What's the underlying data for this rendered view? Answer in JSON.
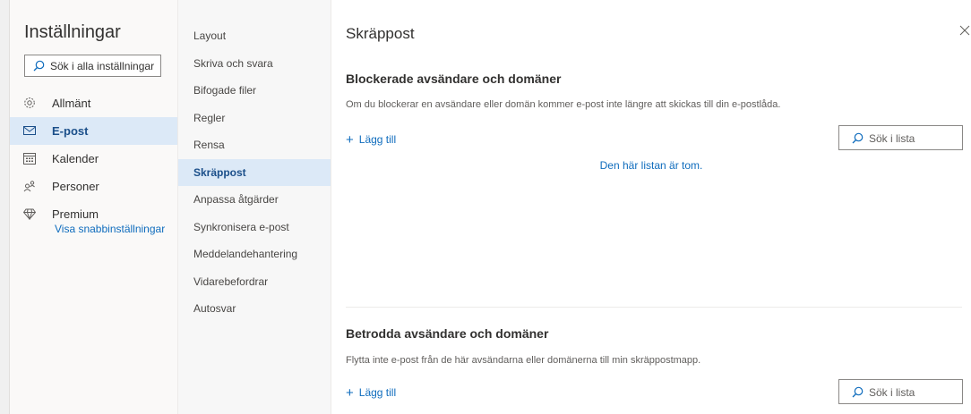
{
  "settings": {
    "title": "Inställningar",
    "search_placeholder": "Sök i alla inställningar",
    "nav": [
      {
        "label": "Allmänt",
        "icon": "gear-icon",
        "selected": false
      },
      {
        "label": "E-post",
        "icon": "mail-icon",
        "selected": true
      },
      {
        "label": "Kalender",
        "icon": "calendar-icon",
        "selected": false
      },
      {
        "label": "Personer",
        "icon": "people-icon",
        "selected": false
      },
      {
        "label": "Premium",
        "icon": "diamond-icon",
        "selected": false
      }
    ],
    "quick_settings_link": "Visa snabbinställningar"
  },
  "mail_nav": {
    "items": [
      {
        "label": "Layout",
        "selected": false
      },
      {
        "label": "Skriva och svara",
        "selected": false
      },
      {
        "label": "Bifogade filer",
        "selected": false
      },
      {
        "label": "Regler",
        "selected": false
      },
      {
        "label": "Rensa",
        "selected": false
      },
      {
        "label": "Skräppost",
        "selected": true
      },
      {
        "label": "Anpassa åtgärder",
        "selected": false
      },
      {
        "label": "Synkronisera e-post",
        "selected": false
      },
      {
        "label": "Meddelandehantering",
        "selected": false
      },
      {
        "label": "Vidarebefordrar",
        "selected": false
      },
      {
        "label": "Autosvar",
        "selected": false
      }
    ]
  },
  "pane": {
    "title": "Skräppost",
    "blocked": {
      "title": "Blockerade avsändare och domäner",
      "description": "Om du blockerar en avsändare eller domän kommer e-post inte längre att skickas till din e-postlåda.",
      "add_label": "Lägg till",
      "search_placeholder": "Sök i lista",
      "empty_text": "Den här listan är tom."
    },
    "trusted": {
      "title": "Betrodda avsändare och domäner",
      "description": "Flytta inte e-post från de här avsändarna eller domänerna till min skräppostmapp.",
      "add_label": "Lägg till",
      "search_placeholder": "Sök i lista"
    }
  },
  "colors": {
    "accent": "#0f6cbd",
    "selected_bg": "#dce9f7",
    "selected_text": "#1b4f8a"
  }
}
